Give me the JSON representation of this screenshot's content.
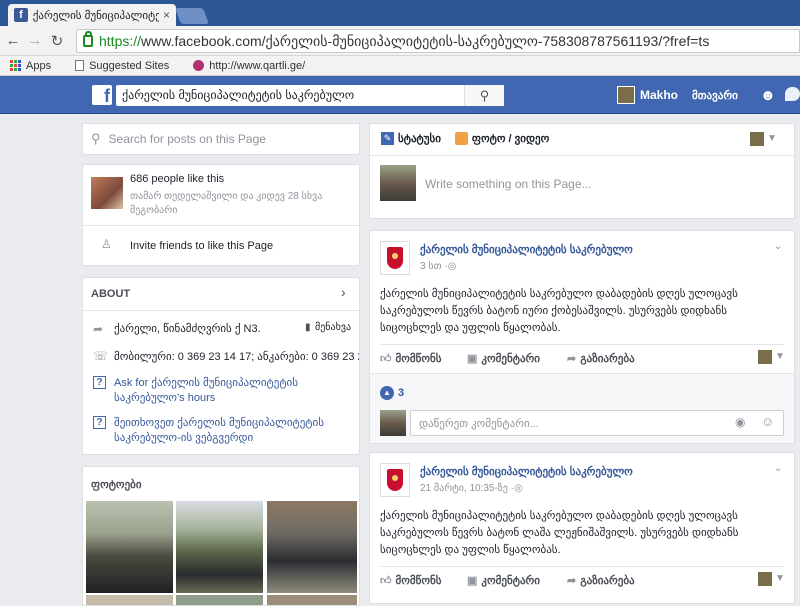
{
  "browser": {
    "tab_title": "ქარელის მუნიციპალიტე",
    "tab_close": "×",
    "url_scheme": "https://",
    "url_rest": "www.facebook.com/ქარელის-მუნიციპალიტეტის-საკრებულო-758308787561193/?fref=ts",
    "bookmarks": [
      "Apps",
      "Suggested Sites",
      "http://www.qartli.ge/"
    ]
  },
  "fb": {
    "logo": "f",
    "search_value": "ქარელის მუნიციპალიტეტის საკრებულო",
    "user_name": "Makho",
    "home_label": "მთავარი"
  },
  "left": {
    "search_placeholder": "Search for posts on this Page",
    "likes_count": "686 people like this",
    "likes_friends": "თამარ თედელაშვილი და კიდევ 28 სხვა მეგობარი",
    "invite": "Invite friends to like this Page",
    "about_title": "ABOUT",
    "address": "ქარელი, წინამძღვრის ქ N3.",
    "address_action": "მენახვა",
    "phone": "მობილური: 0 369 23 14 17; ანკარები: 0 369 23 23",
    "ask_hours_1": "Ask for ქარელის მუნიციპალიტეტის",
    "ask_hours_2": "საკრებულო's hours",
    "suggest_1": "შეითხოვეთ ქარელის მუნიციპალიტეტის",
    "suggest_2": "საკრებულო-ის ვებგვერდი",
    "photos_title": "ფოტოები"
  },
  "composer": {
    "status_tab": "სტატუსი",
    "photo_tab": "ფოტო / ვიდეო",
    "placeholder": "Write something on this Page..."
  },
  "posts": [
    {
      "author": "ქარელის მუნიციპალიტეტის საკრებულო",
      "time": "3 სთ · ",
      "text_1": "ქარელის მუნიციპალიტეტის საკრებულო დაბადების დღეს ულოცავს",
      "text_2": "საკრებულოს წევრს ბატონ იური ქობესაშვილს. უსურვებს დიდხანს",
      "text_3": "სიცოცხლეს და უფლის წყალობას.",
      "like": "მომწონს",
      "comment": "კომენტარი",
      "share": "გაზიარება",
      "reactions": "3",
      "comment_placeholder": "დაწერეთ კომენტარი..."
    },
    {
      "author": "ქარელის მუნიციპალიტეტის საკრებულო",
      "time": "21 მარტი, 10:35-ზე · ",
      "text_1": "ქარელის მუნიციპალიტეტის საკრებულო დაბადების დღეს ულოცავს",
      "text_2": "საკრებულოს წევრს ბატონ ლაშა ლეჟნიშაშვილს. უსურვებს დიდხანს",
      "text_3": "სიცოცხლეს და უფლის წყალობას.",
      "like": "მომწონს",
      "comment": "კომენტარი",
      "share": "გაზიარება"
    }
  ],
  "colors": {
    "fb_blue": "#4267b2",
    "link": "#365899",
    "page_bg": "#e9ebee"
  },
  "icons": [
    "search-icon",
    "thumbs-up-icon",
    "comment-icon",
    "share-icon",
    "camera-icon",
    "smiley-icon",
    "globe-icon",
    "chevron-down-icon",
    "pencil-icon",
    "photo-icon",
    "phone-icon",
    "location-icon",
    "bookmark-icon"
  ]
}
